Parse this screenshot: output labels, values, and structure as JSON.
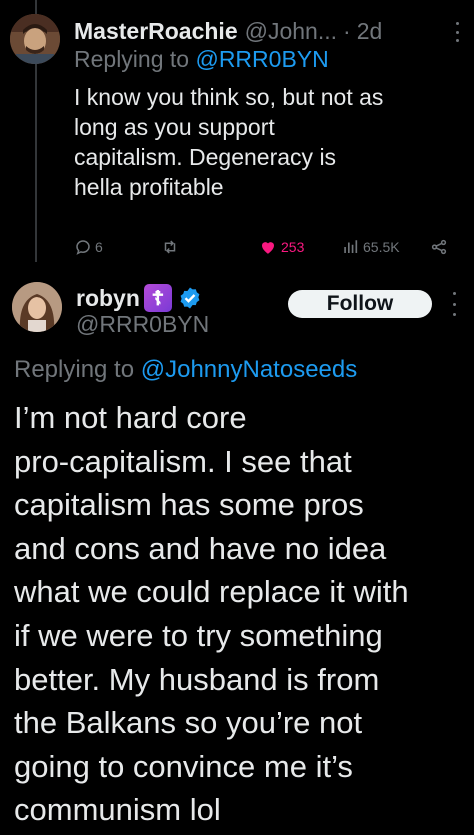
{
  "reply_tweet": {
    "display_name": "MasterRoachie",
    "handle_truncated": "@John...",
    "time_separator": "·",
    "time": "2d",
    "replying_prefix": "Replying to",
    "replying_handle": "@RRR0BYN",
    "text_lines": [
      "I know you think so, but not as",
      "long as you support",
      "capitalism. Degeneracy is",
      "hella profitable"
    ],
    "stats": {
      "replies": "6",
      "retweets": "",
      "likes": "253",
      "views": "65.5K"
    },
    "colors": {
      "like": "#f91880",
      "link": "#1d9bf0",
      "muted": "#71767b"
    }
  },
  "main_tweet": {
    "display_name": "robyn",
    "badge_glyph": "☦",
    "handle": "@RRR0BYN",
    "follow_label": "Follow",
    "replying_prefix": "Replying to",
    "replying_handle": "@JohnnyNatoseeds",
    "text_lines": [
      "I’m not hard core",
      "pro-capitalism. I see that",
      "capitalism has some pros",
      "and cons and have no idea",
      "what we could replace it with",
      "if we were to try something",
      "better. My husband is from",
      "the Balkans so you’re not",
      "going to convince me it’s",
      "communism lol"
    ],
    "colors": {
      "verified": "#1d9bf0",
      "badge": "#9b45d8"
    }
  }
}
